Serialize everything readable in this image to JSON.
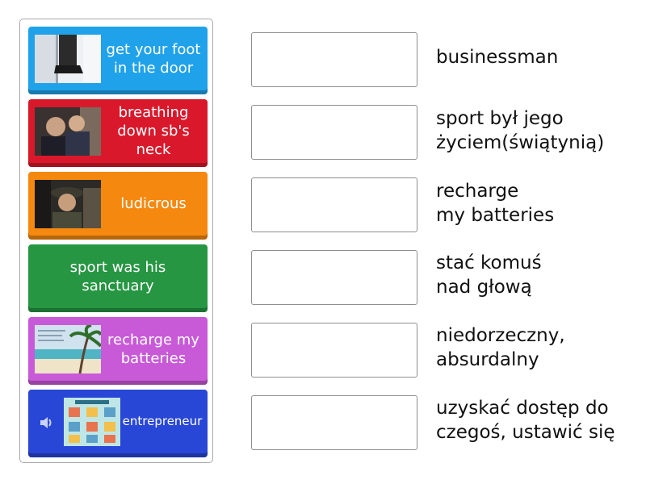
{
  "colors": {
    "tile_blue": "#1fa2ea",
    "tile_red": "#d9192b",
    "tile_orange": "#f5880f",
    "tile_green": "#269642",
    "tile_purple": "#c85ad8",
    "tile_navy": "#2947d6"
  },
  "tiles": [
    {
      "label": "get your foot in the door",
      "image": "foot-in-door-photo"
    },
    {
      "label": "breathing down sb's neck",
      "image": "two-men-photo"
    },
    {
      "label": "ludicrous",
      "image": "soldier-photo"
    },
    {
      "label": "sport was his sanctuary",
      "image": null
    },
    {
      "label": "recharge my batteries",
      "image": "beach-palm-photo"
    },
    {
      "label": "entrepreneur",
      "image": "infographic-photo",
      "icon": "speaker-icon"
    }
  ],
  "targets": [
    "businessman",
    "sport był jego\nżyciem(świątynią)",
    "recharge\nmy batteries",
    "stać komuś\nnad głową",
    "niedorzeczny,\nabsurdalny",
    "uzyskać dostęp do\nczegoś, ustawić się"
  ]
}
